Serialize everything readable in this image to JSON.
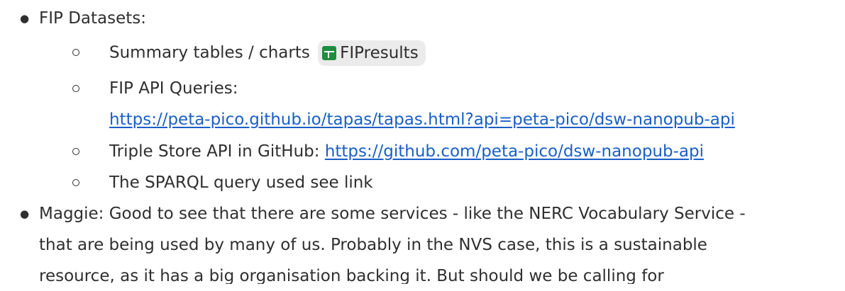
{
  "items": {
    "fip_datasets": "FIP Datasets:",
    "summary_label": "Summary tables / charts",
    "summary_chip": {
      "icon": "google-sheets-icon",
      "label": "FIPresults",
      "icon_color": "#1e8e3e"
    },
    "api_queries_label": "FIP API Queries:",
    "api_queries_link": "https://peta-pico.github.io/tapas/tapas.html?api=peta-pico/dsw-nanopub-api",
    "triple_store_label": "Triple Store API in GitHub: ",
    "triple_store_link": "https://github.com/peta-pico/dsw-nanopub-api",
    "sparql_label": "The SPARQL query used see link",
    "maggie_lines": [
      "Maggie: Good to see that there are some services - like the NERC Vocabulary Service -",
      "that are being used by many of us. Probably in the NVS case, this is a sustainable",
      "resource, as it has a big organisation backing it. But should we be calling for"
    ]
  },
  "colors": {
    "text": "#2f2f2f",
    "link": "#1a5fc7",
    "chip_bg": "#ebebeb"
  }
}
